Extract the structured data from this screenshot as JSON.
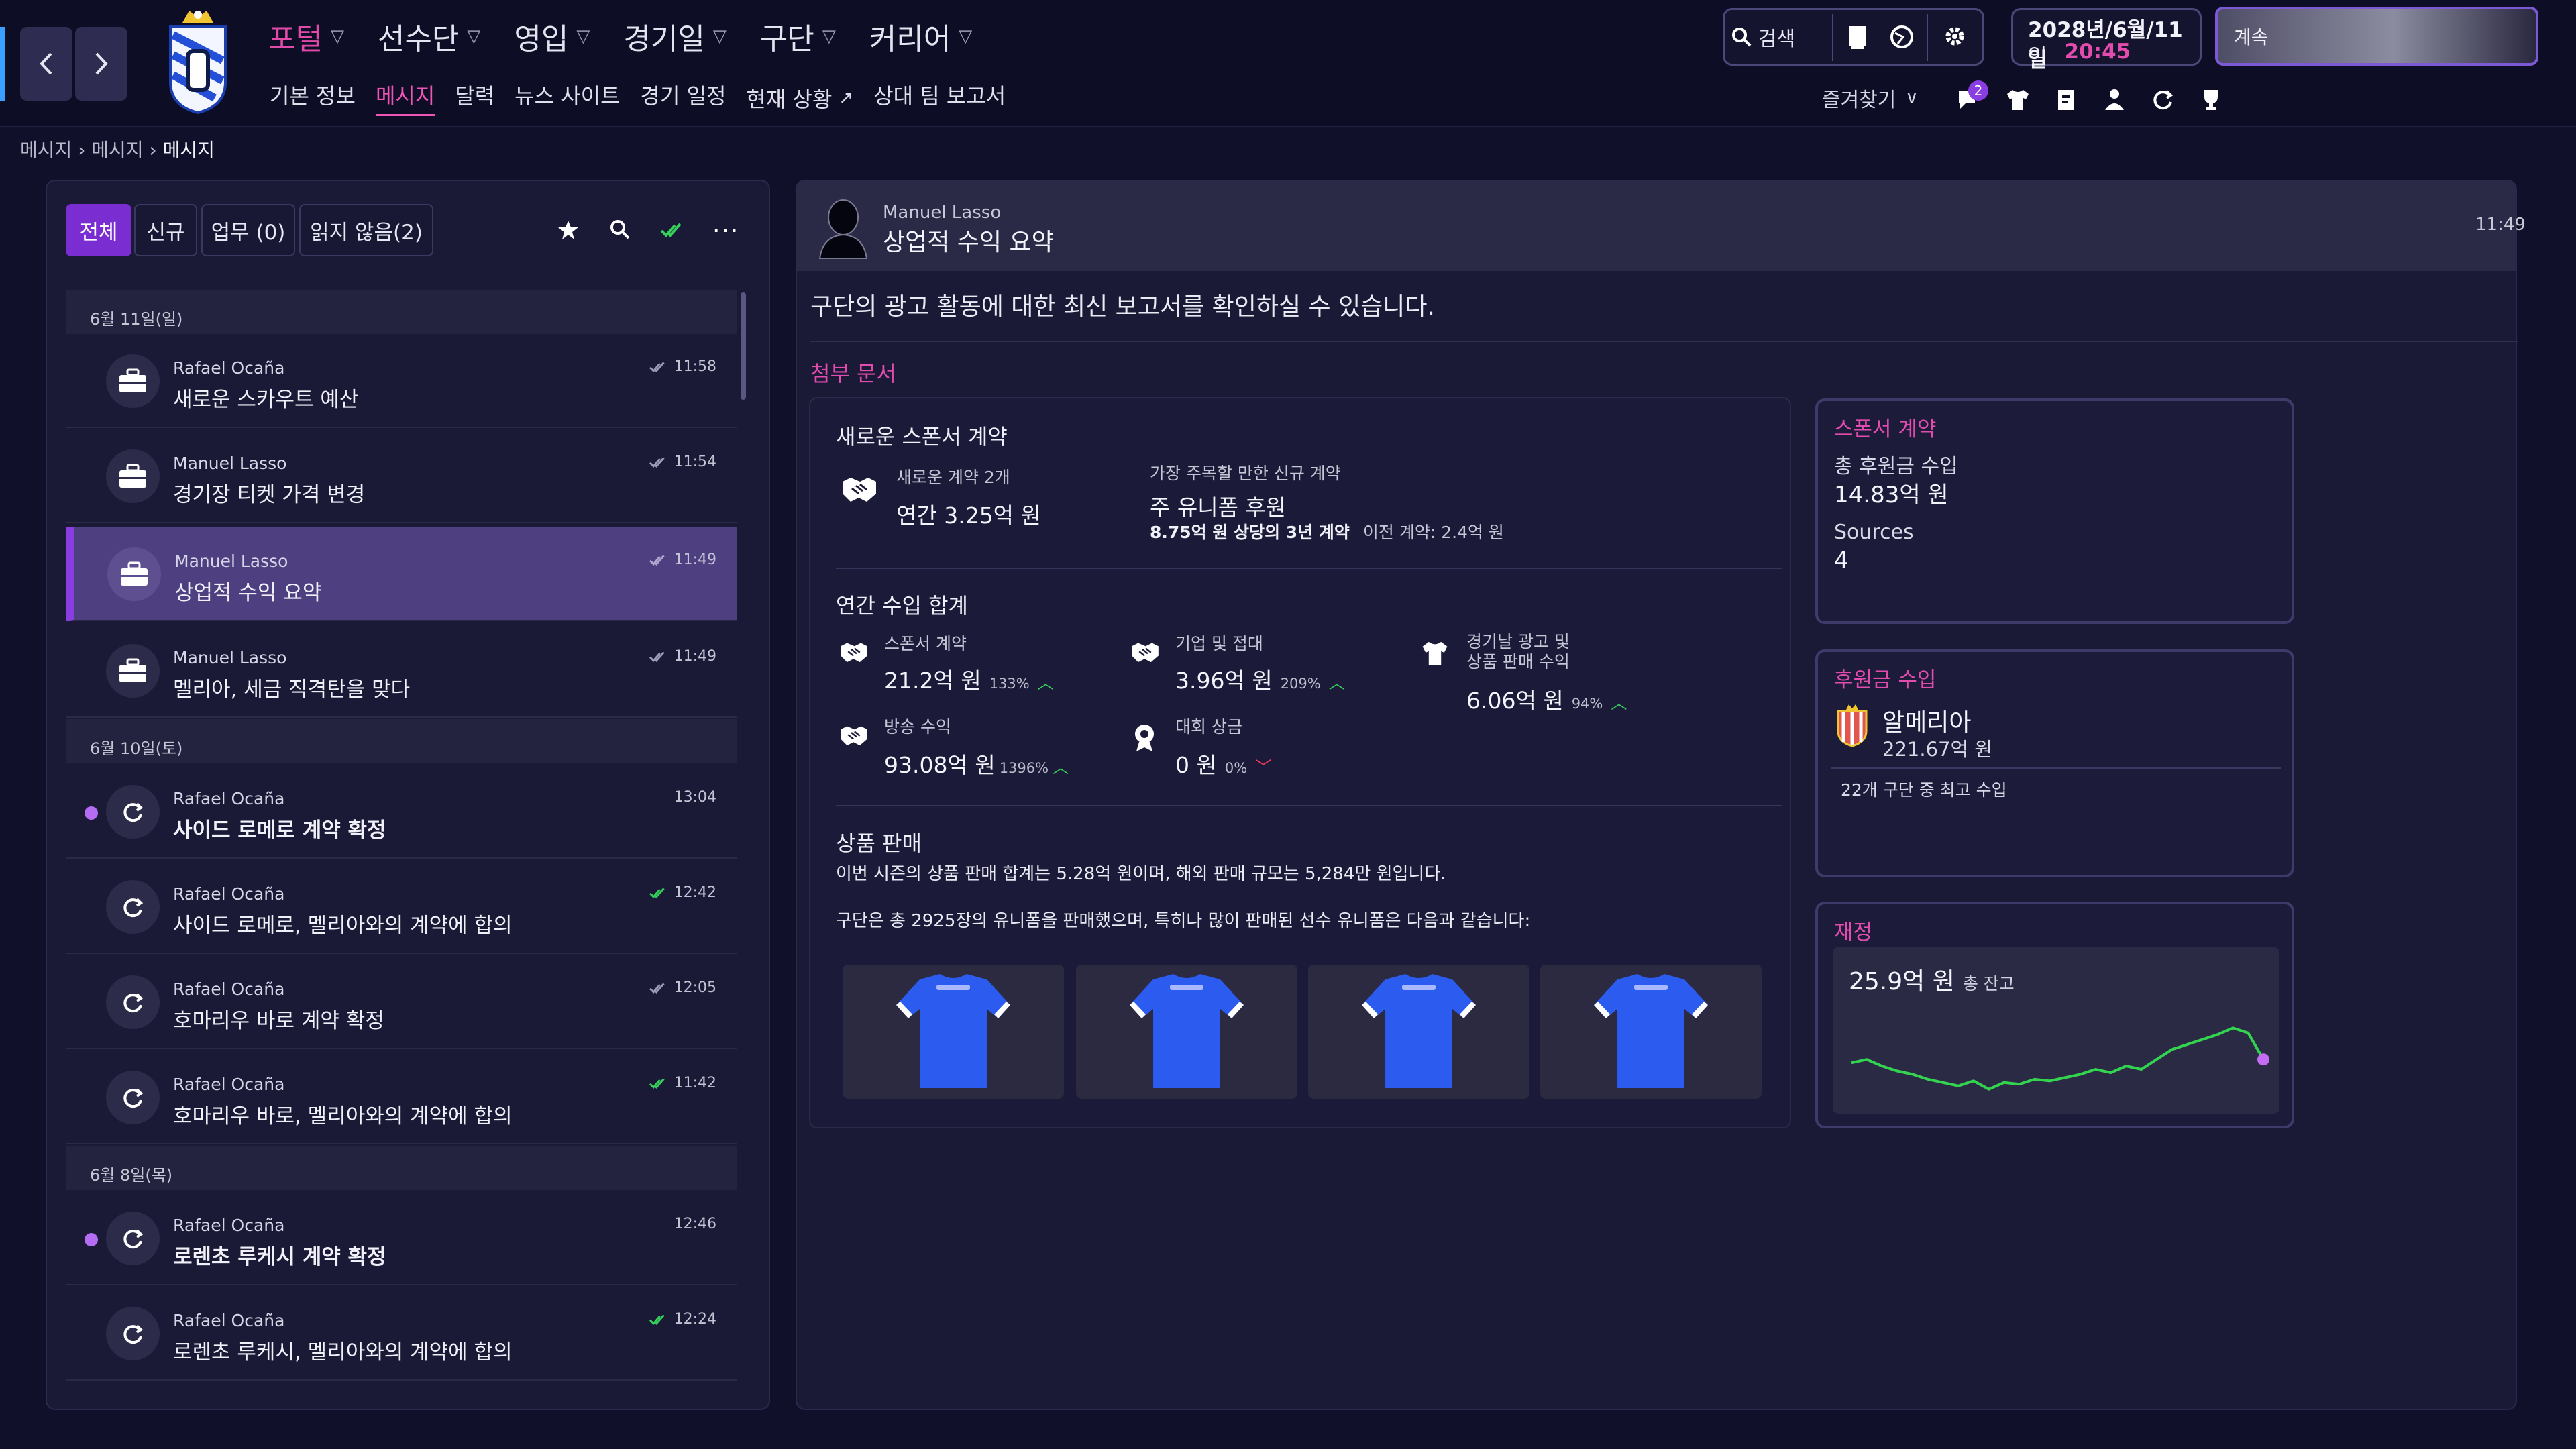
{
  "header": {
    "menu": [
      {
        "label": "포털",
        "active": true
      },
      {
        "label": "선수단"
      },
      {
        "label": "영입"
      },
      {
        "label": "경기일"
      },
      {
        "label": "구단"
      },
      {
        "label": "커리어"
      }
    ],
    "submenu": [
      {
        "label": "기본 정보"
      },
      {
        "label": "메시지",
        "active": true
      },
      {
        "label": "달력"
      },
      {
        "label": "뉴스 사이트"
      },
      {
        "label": "경기 일정"
      },
      {
        "label": "현재 상황"
      },
      {
        "label": "상대 팀 보고서"
      }
    ],
    "search_label": "검색",
    "date": "2028년/6월/11일",
    "weekday": "일",
    "time": "20:45",
    "continue_label": "계속",
    "favorites_label": "즐겨찾기",
    "notification_count": "2",
    "colors": {
      "accent": "#e04aa8",
      "active_filter": "#7a2ed2",
      "selected_row": "#4e3f80"
    }
  },
  "breadcrumb": [
    "메시지",
    "메시지",
    "메시지"
  ],
  "inbox": {
    "filters": [
      {
        "label": "전체",
        "active": true
      },
      {
        "label": "신규"
      },
      {
        "label": "업무 (0)"
      },
      {
        "label": "읽지 않음(2)"
      }
    ],
    "groups": [
      {
        "date": "6월 11일(일)",
        "messages": [
          {
            "sender": "Rafael Ocaña",
            "subject": "새로운 스카우트 예산",
            "time": "11:58",
            "icon": "briefcase-icon"
          },
          {
            "sender": "Manuel Lasso",
            "subject": "경기장 티켓 가격 변경",
            "time": "11:54",
            "icon": "briefcase-icon"
          },
          {
            "sender": "Manuel Lasso",
            "subject": "상업적 수익 요약",
            "time": "11:49",
            "icon": "briefcase-icon",
            "selected": true
          },
          {
            "sender": "Manuel Lasso",
            "subject": "멜리아, 세금 직격탄을 맞다",
            "time": "11:49",
            "icon": "briefcase-icon"
          }
        ]
      },
      {
        "date": "6월 10일(토)",
        "messages": [
          {
            "sender": "Rafael Ocaña",
            "subject": "사이드 로메로 계약 확정",
            "time": "13:04",
            "icon": "refresh-icon",
            "unread": true
          },
          {
            "sender": "Rafael Ocaña",
            "subject": "사이드 로메로, 멜리아와의 계약에 합의",
            "time": "12:42",
            "icon": "refresh-icon"
          },
          {
            "sender": "Rafael Ocaña",
            "subject": "호마리우 바로 계약 확정",
            "time": "12:05",
            "icon": "refresh-icon"
          },
          {
            "sender": "Rafael Ocaña",
            "subject": "호마리우 바로, 멜리아와의 계약에 합의",
            "time": "11:42",
            "icon": "refresh-icon"
          }
        ]
      },
      {
        "date": "6월 8일(목)",
        "messages": [
          {
            "sender": "Rafael Ocaña",
            "subject": "로렌초 루케시 계약 확정",
            "time": "12:46",
            "icon": "refresh-icon",
            "unread": true
          },
          {
            "sender": "Rafael Ocaña",
            "subject": "로렌초 루케시, 멜리아와의 계약에 합의",
            "time": "12:24",
            "icon": "refresh-icon"
          }
        ]
      }
    ]
  },
  "message": {
    "sender": "Manuel Lasso",
    "subject": "상업적 수익 요약",
    "time": "11:49",
    "body": "구단의 광고 활동에 대한 최신 보고서를 확인하실 수 있습니다.",
    "attachments_label": "첨부 문서",
    "sponsors": {
      "title": "새로운 스폰서 계약",
      "new_count": "새로운 계약 2개",
      "annual": "연간 3.25억 원",
      "notable_label": "가장 주목할 만한 신규 계약",
      "notable_name": "주 유니폼 후원",
      "notable_detail": "8.75억 원 상당의 3년 계약",
      "previous": "이전 계약: 2.4억 원"
    },
    "annual_income": {
      "title": "연간 수입 합계",
      "items": [
        {
          "label": "스폰서 계약",
          "value": "21.2억 원",
          "pct": "133%",
          "trend": "up"
        },
        {
          "label": "기업 및 접대",
          "value": "3.96억 원",
          "pct": "209%",
          "trend": "up"
        },
        {
          "label": "경기날 광고 및",
          "label2": "상품 판매 수익",
          "value": "6.06억 원",
          "pct": "94%",
          "trend": "up"
        },
        {
          "label": "방송 수익",
          "value": "93.08억 원",
          "pct": "1396%",
          "trend": "up"
        },
        {
          "label": "대회 상금",
          "value": "0 원",
          "pct": "0%",
          "trend": "down"
        }
      ]
    },
    "merch": {
      "title": "상품 판매",
      "line1": "이번 시즌의 상품 판매 합계는 5.28억 원이며, 해외 판매 규모는 5,284만 원입니다.",
      "line2": "구단은 총 2925장의 유니폼을 판매했으며, 특히나 많이 판매된 선수 유니폼은 다음과 같습니다:"
    }
  },
  "side": {
    "sponsor": {
      "title": "스폰서 계약",
      "total_label": "총 후원금 수입",
      "total_value": "14.83억 원",
      "sources_label": "Sources",
      "sources_value": "4"
    },
    "sponsor_income": {
      "title": "후원금 수입",
      "club": "알메리아",
      "value": "221.67억 원",
      "note": "22개 구단 중 최고 수입"
    },
    "finance": {
      "title": "재정",
      "balance": "25.9억 원",
      "balance_label": "총 잔고"
    }
  },
  "chart_data": {
    "type": "line",
    "title": "",
    "series": [
      {
        "values": [
          62,
          64,
          60,
          57,
          55,
          52,
          50,
          48,
          51,
          46,
          50,
          49,
          52,
          51,
          53,
          55,
          58,
          56,
          60,
          58,
          64,
          70,
          73,
          76,
          79,
          83,
          80,
          64
        ]
      }
    ],
    "color": "#33d44f",
    "end_marker_color": "#c46cf2",
    "grid": false
  }
}
